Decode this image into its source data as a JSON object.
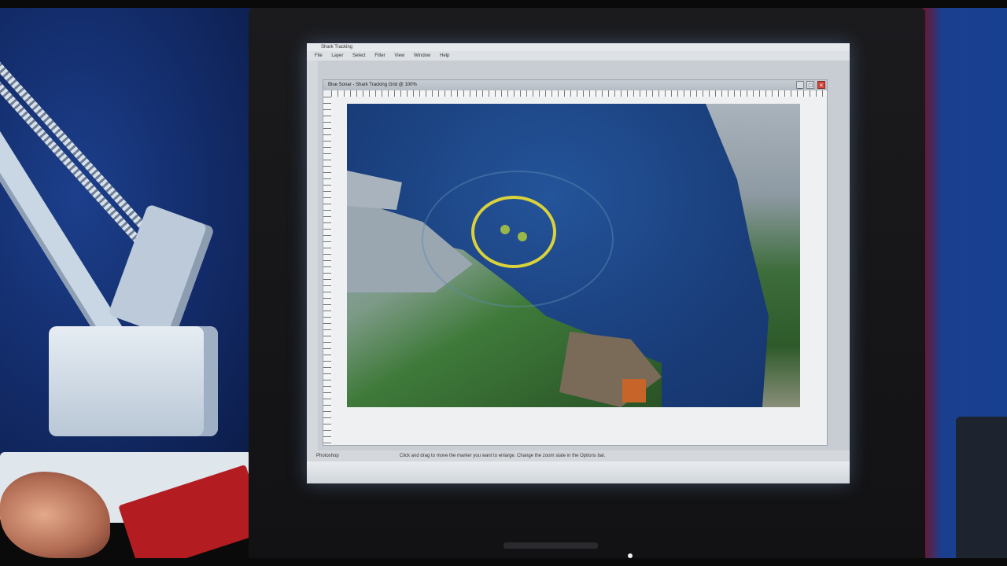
{
  "app": {
    "title": "Shark Tracking",
    "menu": [
      "File",
      "Layer",
      "Select",
      "Filter",
      "View",
      "Window",
      "Help"
    ]
  },
  "document": {
    "title": "Blue Sonar - Shark Tracking Grid @ 100%",
    "controls": [
      "_",
      "□",
      "×"
    ]
  },
  "status": {
    "left": "Photoshop",
    "right": "Click and drag to move the marker you want to enlarge. Change the zoom state in the Options bar."
  },
  "map": {
    "targets": 2
  },
  "colors": {
    "target_ring": "#d9d23a",
    "water": "#1a3f7c",
    "land_green": "#3f7a3a"
  }
}
